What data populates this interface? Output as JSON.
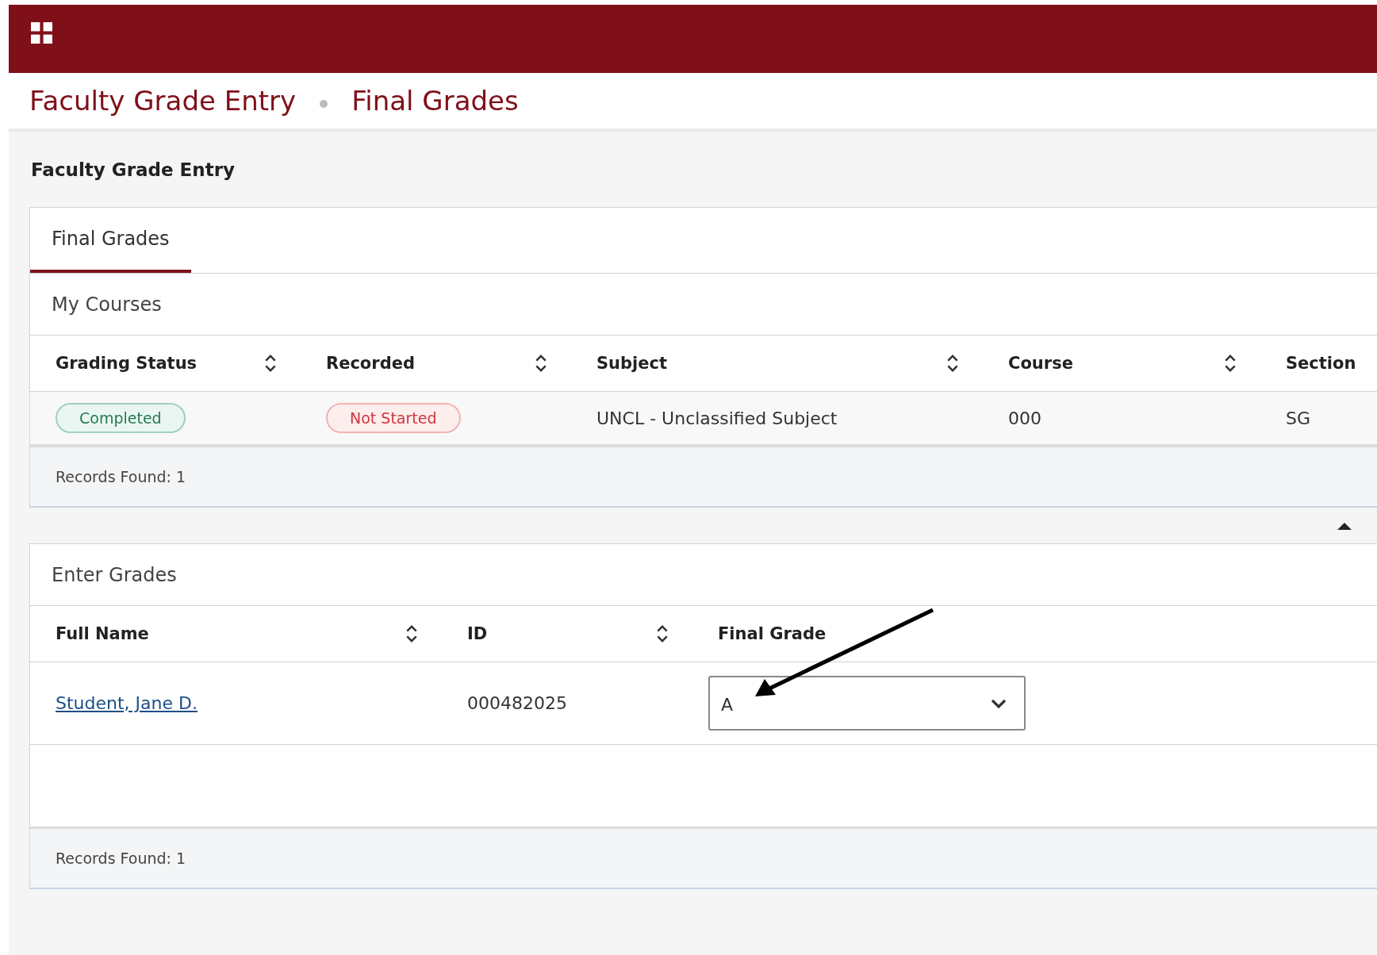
{
  "breadcrumb": [
    "Faculty Grade Entry",
    "Final Grades"
  ],
  "page_title": "Faculty Grade Entry",
  "tabs": [
    {
      "label": "Final Grades",
      "selected": true
    }
  ],
  "my_courses": {
    "title": "My Courses",
    "columns": [
      {
        "label": "Grading Status",
        "sortable": true
      },
      {
        "label": "Recorded",
        "sortable": true
      },
      {
        "label": "Subject",
        "sortable": true
      },
      {
        "label": "Course",
        "sortable": true
      },
      {
        "label": "Section",
        "sortable": false
      }
    ],
    "rows": [
      {
        "grading_status": {
          "text": "Completed",
          "kind": "success"
        },
        "recorded": {
          "text": "Not Started",
          "kind": "danger"
        },
        "subject": "UNCL - Unclassified Subject",
        "course": "000",
        "section": "SG"
      }
    ],
    "records_found": "Records Found: 1"
  },
  "enter_grades": {
    "title": "Enter Grades",
    "columns": [
      {
        "label": "Full Name",
        "sortable": true
      },
      {
        "label": "ID",
        "sortable": true
      },
      {
        "label": "Final Grade",
        "sortable": false
      }
    ],
    "rows": [
      {
        "full_name": "Student, Jane D.",
        "id": "000482025",
        "final_grade": "A"
      }
    ],
    "records_found": "Records Found: 1"
  }
}
